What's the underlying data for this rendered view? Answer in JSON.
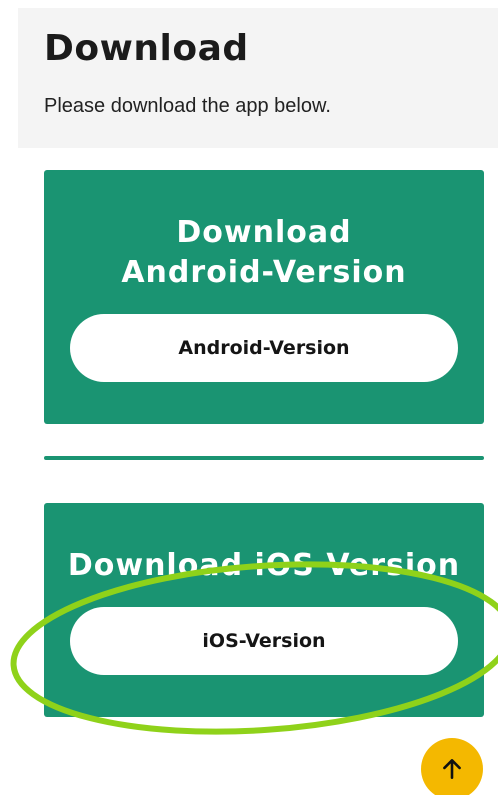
{
  "header": {
    "title": "Download",
    "subtitle": "Please download the app below."
  },
  "android": {
    "heading": "Download Android-Version",
    "button_label": "Android-Version"
  },
  "ios": {
    "heading": "Download iOS Version",
    "button_label": "iOS-Version"
  },
  "colors": {
    "card_green": "#1a9472",
    "annotation_highlight": "#8fd21a",
    "scroll_button": "#f4b800"
  },
  "icons": {
    "scroll_top": "arrow-up-icon"
  }
}
